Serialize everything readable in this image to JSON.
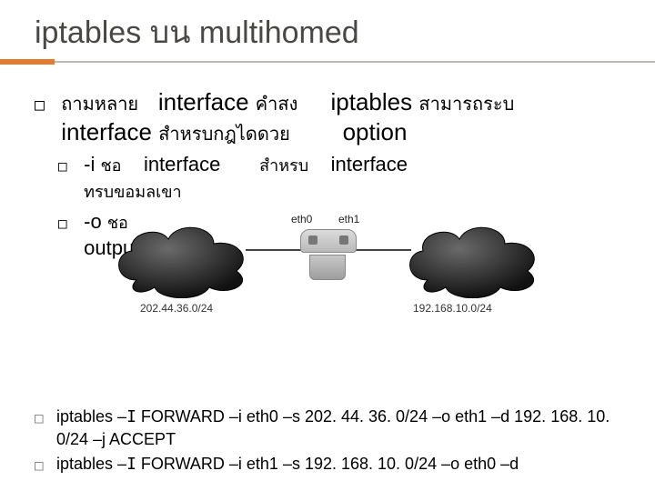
{
  "title": "iptables บน multihomed",
  "intro": {
    "a": "ถามหลาย",
    "interface1": "interface",
    "b": " คำสง",
    "iptables": "iptables",
    "c": " สามารถระบ",
    "interface2": "interface",
    "d": " สำหรบกฎไดดวย",
    "option": "option"
  },
  "sub_i": {
    "flag": "-i ",
    "a": "ชอ",
    "iface": "interface",
    "b": "สำหรบ",
    "iface2": "interface",
    "tail": "ทรบขอมลเขา"
  },
  "sub_o": {
    "flag": "-o ",
    "a": "ชอ",
    "output": "outpu"
  },
  "diagram": {
    "eth0": "eth0",
    "eth1": "eth1",
    "subnet_left": "202.44.36.0/24",
    "subnet_right": "192.168.10.0/24"
  },
  "commands": [
    {
      "pre": "iptables  –",
      "I": "I",
      "post": " FORWARD  –i eth0  –s 202. 44. 36. 0/24  –o eth1  –d 192. 168. 10. 0/24  –j ACCEPT"
    },
    {
      "pre": "iptables  –",
      "I": "I",
      "post": " FORWARD  –i eth1  –s 192. 168. 10. 0/24  –o eth0  –d"
    }
  ]
}
